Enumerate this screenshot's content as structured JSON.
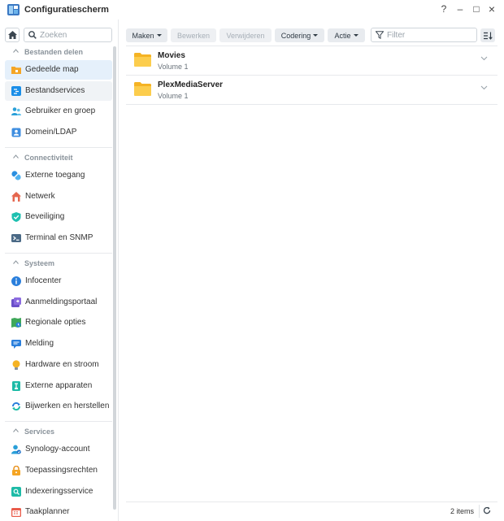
{
  "window": {
    "title": "Configuratiescherm",
    "controls": [
      "?",
      "–",
      "□",
      "×"
    ]
  },
  "sidebar": {
    "search_placeholder": "Zoeken",
    "sections": [
      {
        "title": "Bestanden delen",
        "items": [
          {
            "label": "Gedeelde map",
            "icon": "shared-folder-icon"
          },
          {
            "label": "Bestandservices",
            "icon": "file-services-icon"
          },
          {
            "label": "Gebruiker en groep",
            "icon": "user-group-icon"
          },
          {
            "label": "Domein/LDAP",
            "icon": "domain-ldap-icon"
          }
        ]
      },
      {
        "title": "Connectiviteit",
        "items": [
          {
            "label": "Externe toegang",
            "icon": "external-access-icon"
          },
          {
            "label": "Netwerk",
            "icon": "network-icon"
          },
          {
            "label": "Beveiliging",
            "icon": "security-shield-icon"
          },
          {
            "label": "Terminal en SNMP",
            "icon": "terminal-icon"
          }
        ]
      },
      {
        "title": "Systeem",
        "items": [
          {
            "label": "Infocenter",
            "icon": "info-icon"
          },
          {
            "label": "Aanmeldingsportaal",
            "icon": "login-portal-icon"
          },
          {
            "label": "Regionale opties",
            "icon": "regional-options-icon"
          },
          {
            "label": "Melding",
            "icon": "notification-icon"
          },
          {
            "label": "Hardware en stroom",
            "icon": "hardware-power-icon"
          },
          {
            "label": "Externe apparaten",
            "icon": "external-devices-icon"
          },
          {
            "label": "Bijwerken en herstellen",
            "icon": "update-restore-icon"
          }
        ]
      },
      {
        "title": "Services",
        "items": [
          {
            "label": "Synology-account",
            "icon": "synology-account-icon"
          },
          {
            "label": "Toepassingsrechten",
            "icon": "app-privileges-icon"
          },
          {
            "label": "Indexeringsservice",
            "icon": "indexing-service-icon"
          },
          {
            "label": "Taakplanner",
            "icon": "task-scheduler-icon"
          }
        ]
      }
    ]
  },
  "toolbar": {
    "create": "Maken",
    "edit": "Bewerken",
    "delete": "Verwijderen",
    "encoding": "Codering",
    "action": "Actie",
    "filter_placeholder": "Filter"
  },
  "folders": [
    {
      "name": "Movies",
      "volume": "Volume 1"
    },
    {
      "name": "PlexMediaServer",
      "volume": "Volume 1"
    }
  ],
  "footer": {
    "count": "2 items"
  },
  "colors": {
    "active_bg": "#e5f0fb",
    "folder": "#f7c23a",
    "accent": "#1a8ee8"
  }
}
